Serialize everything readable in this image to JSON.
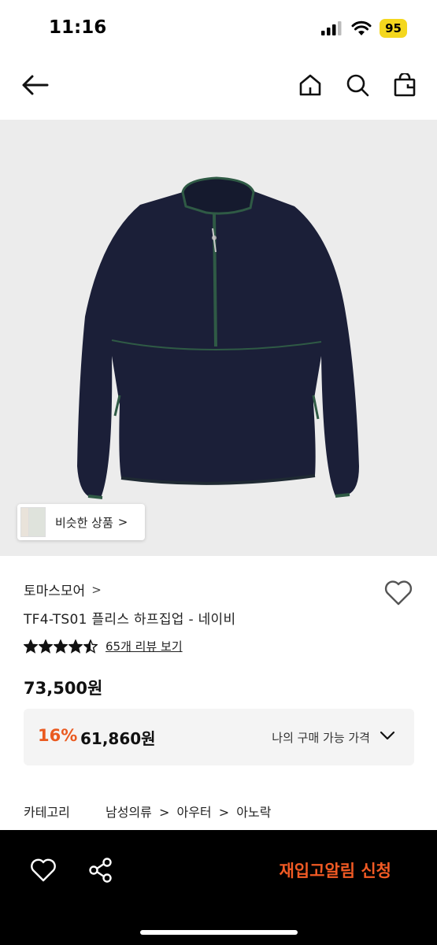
{
  "status": {
    "time": "11:16",
    "battery": "95"
  },
  "nav": {
    "back_icon": "arrow-left-icon",
    "home_icon": "home-icon",
    "search_icon": "search-icon",
    "bag_icon": "shopping-bag-icon"
  },
  "hero": {
    "similar_label": "비슷한 상품",
    "similar_arrow": ">"
  },
  "product": {
    "brand": "토마스모어",
    "brand_arrow": ">",
    "name": "TF4-TS01 플리스 하프집업 - 네이비",
    "rating": 4.5,
    "review_link": "65개 리뷰 보기",
    "price": "73,500원",
    "discount": "16%",
    "sale_price": "61,860원",
    "my_price_label": "나의 구매 가능 가격"
  },
  "category": {
    "label": "카테고리",
    "path": [
      "남성의류",
      ">",
      "아우터",
      ">",
      "아노락"
    ]
  },
  "bottom": {
    "restock_label": "재입고알림 신청"
  },
  "colors": {
    "accent": "#ea5a20",
    "restock": "#f15a24",
    "garment": "#1b1f38",
    "trim": "#2f5a45"
  }
}
